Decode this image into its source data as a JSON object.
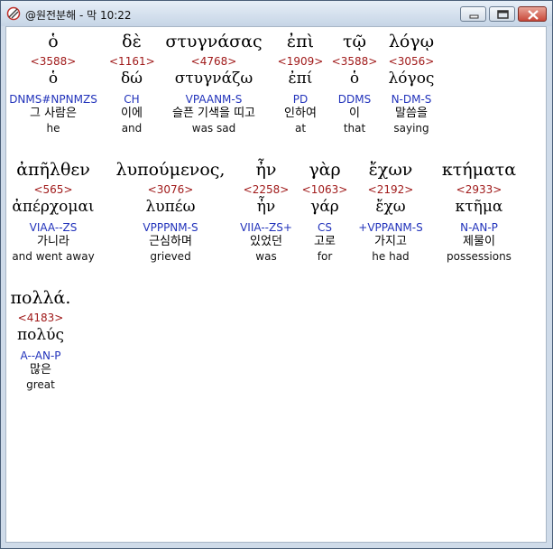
{
  "window": {
    "title": "@원전분해 - 막 10:22"
  },
  "rows": [
    {
      "words": [
        {
          "greek": "ὁ",
          "num": "<3588>",
          "lemma": "ὁ",
          "parse": "DNMS#NPNMZS",
          "kor": "그 사람은",
          "eng": "he"
        },
        {
          "greek": "δὲ",
          "num": "<1161>",
          "lemma": "δώ",
          "parse": "CH",
          "kor": "이에",
          "eng": "and"
        },
        {
          "greek": "στυγνάσας",
          "num": "<4768>",
          "lemma": "στυγνάζω",
          "parse": "VPAANM-S",
          "kor": "슬픈 기색을 띠고",
          "eng": "was sad"
        },
        {
          "greek": "ἐπὶ",
          "num": "<1909>",
          "lemma": "ἐπί",
          "parse": "PD",
          "kor": "인하여",
          "eng": "at"
        },
        {
          "greek": "τῷ",
          "num": "<3588>",
          "lemma": "ὁ",
          "parse": "DDMS",
          "kor": "이",
          "eng": "that"
        },
        {
          "greek": "λόγῳ",
          "num": "<3056>",
          "lemma": "λόγος",
          "parse": "N-DM-S",
          "kor": "말씀을",
          "eng": "saying"
        }
      ]
    },
    {
      "words": [
        {
          "greek": "ἀπῆλθεν",
          "num": "<565>",
          "lemma": "ἀπέρχομαι",
          "parse": "VIAA--ZS",
          "kor": "가니라",
          "eng": "and went away"
        },
        {
          "greek": "λυπούμενος,",
          "num": "<3076>",
          "lemma": "λυπέω",
          "parse": "VPPPNM-S",
          "kor": "근심하며",
          "eng": "grieved"
        },
        {
          "greek": "ἦν",
          "num": "<2258>",
          "lemma": "ἦν",
          "parse": "VIIA--ZS+",
          "kor": "있었던",
          "eng": "was"
        },
        {
          "greek": "γὰρ",
          "num": "<1063>",
          "lemma": "γάρ",
          "parse": "CS",
          "kor": "고로",
          "eng": "for"
        },
        {
          "greek": "ἔχων",
          "num": "<2192>",
          "lemma": "ἔχω",
          "parse": "+VPPANM-S",
          "kor": "가지고",
          "eng": "he had"
        },
        {
          "greek": "κτήματα",
          "num": "<2933>",
          "lemma": "κτῆμα",
          "parse": "N-AN-P",
          "kor": "제물이",
          "eng": "possessions"
        }
      ]
    },
    {
      "words": [
        {
          "greek": "πολλά.",
          "num": "<4183>",
          "lemma": "πολύς",
          "parse": "A--AN-P",
          "kor": "많은",
          "eng": "great"
        }
      ]
    }
  ]
}
